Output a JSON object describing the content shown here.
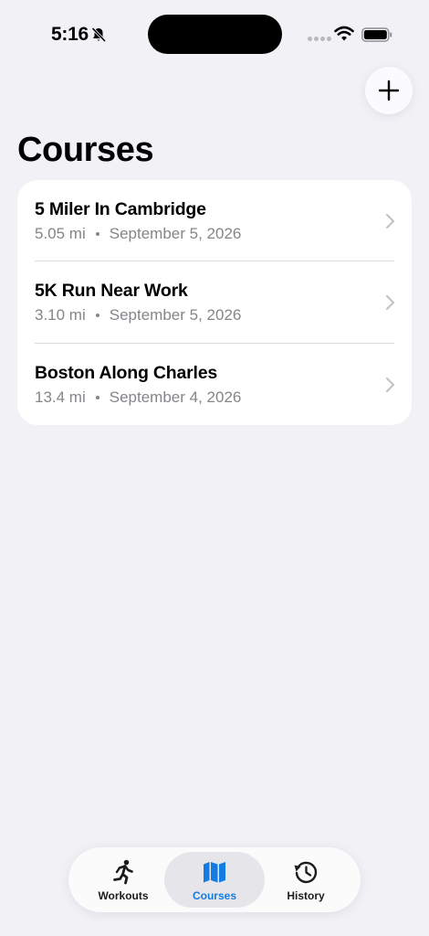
{
  "status_bar": {
    "time": "5:16"
  },
  "header": {
    "title": "Courses"
  },
  "courses": [
    {
      "name": "5 Miler In Cambridge",
      "distance": "5.05 mi",
      "date": "September 5, 2026"
    },
    {
      "name": "5K Run Near Work",
      "distance": "3.10 mi",
      "date": "September 5, 2026"
    },
    {
      "name": "Boston Along Charles",
      "distance": "13.4 mi",
      "date": "September 4, 2026"
    }
  ],
  "tabs": [
    {
      "label": "Workouts",
      "icon": "running-figure-icon",
      "selected": false
    },
    {
      "label": "Courses",
      "icon": "map-icon",
      "selected": true
    },
    {
      "label": "History",
      "icon": "history-icon",
      "selected": false
    }
  ],
  "colors": {
    "accent": "#147ce0",
    "background": "#f2f1f6",
    "secondary_text": "#85858a"
  }
}
